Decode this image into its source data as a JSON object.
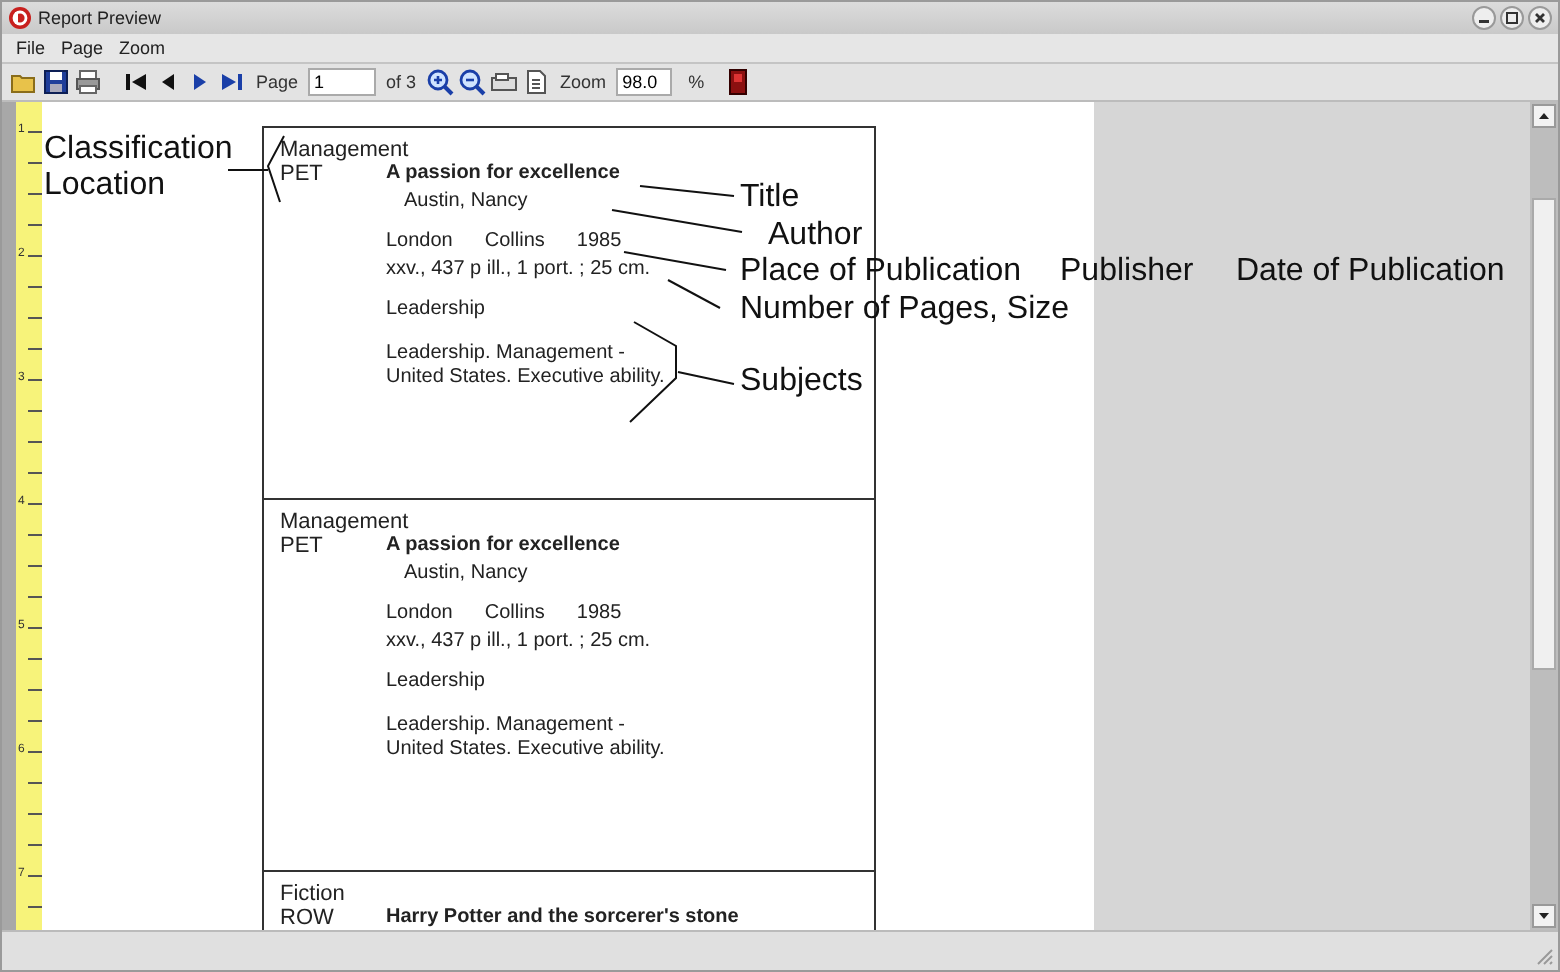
{
  "window": {
    "title": "Report Preview"
  },
  "menu": [
    {
      "label": "File"
    },
    {
      "label": "Page"
    },
    {
      "label": "Zoom"
    }
  ],
  "toolbar": {
    "page_label": "Page",
    "page_value": "1",
    "page_count": "of 3",
    "zoom_label": "Zoom",
    "zoom_value": "98.0",
    "zoom_unit": "%"
  },
  "ruler": {
    "labels": [
      "1",
      "2",
      "3",
      "4",
      "5",
      "6",
      "7"
    ]
  },
  "records": [
    {
      "classification": "Management",
      "location": "PET",
      "title": "A passion for excellence",
      "author": "Austin, Nancy",
      "place": "London",
      "publisher": "Collins",
      "date": "1985",
      "collation": "xxv., 437 p  ill., 1 port. ; 25 cm.",
      "subject_heading": "Leadership",
      "subjects": "Leadership. Management - United States. Executive ability."
    },
    {
      "classification": "Management",
      "location": "PET",
      "title": "A passion for excellence",
      "author": "Austin, Nancy",
      "place": "London",
      "publisher": "Collins",
      "date": "1985",
      "collation": "xxv., 437 p  ill., 1 port. ; 25 cm.",
      "subject_heading": "Leadership",
      "subjects": "Leadership. Management - United States. Executive ability."
    },
    {
      "classification": "Fiction",
      "location": "ROW",
      "title": "Harry Potter and the sorcerer's stone"
    }
  ],
  "annotations": [
    {
      "kind": "classification",
      "label": "Classification"
    },
    {
      "kind": "location",
      "label": "Location"
    },
    {
      "kind": "title",
      "label": "Title"
    },
    {
      "kind": "author",
      "label": "Author"
    },
    {
      "kind": "place",
      "label": "Place of Publication"
    },
    {
      "kind": "publisher",
      "label": "Publisher"
    },
    {
      "kind": "date",
      "label": "Date of Publication"
    },
    {
      "kind": "collation",
      "label": "Number of Pages, Size"
    },
    {
      "kind": "subjects",
      "label": "Subjects"
    }
  ]
}
